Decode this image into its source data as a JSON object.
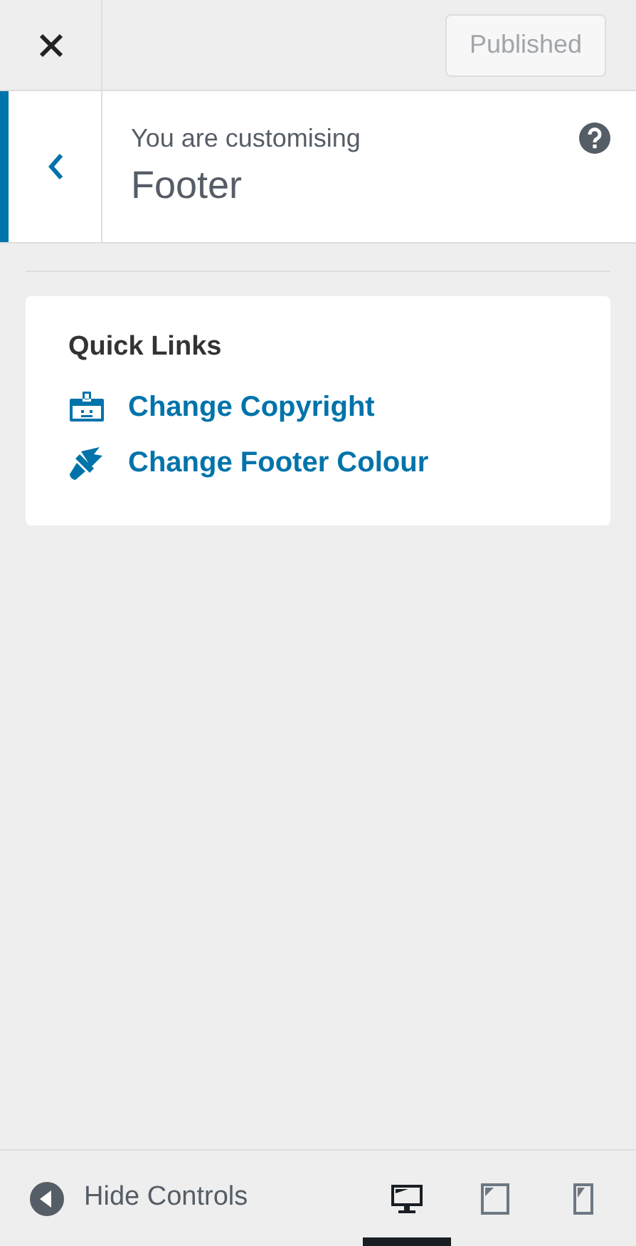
{
  "header": {
    "publish_button": {
      "label": "Published",
      "disabled": true
    }
  },
  "section": {
    "eyebrow": "You are customising",
    "title": "Footer"
  },
  "quick_links": {
    "title": "Quick Links",
    "links": [
      {
        "kind": "badge",
        "label": "Change Copyright"
      },
      {
        "kind": "brush",
        "label": "Change Footer Colour"
      }
    ]
  },
  "footer": {
    "hide_controls": "Hide Controls",
    "devices": [
      {
        "kind": "desktop",
        "selected": true
      },
      {
        "kind": "tablet",
        "selected": false
      },
      {
        "kind": "mobile",
        "selected": false
      }
    ]
  }
}
